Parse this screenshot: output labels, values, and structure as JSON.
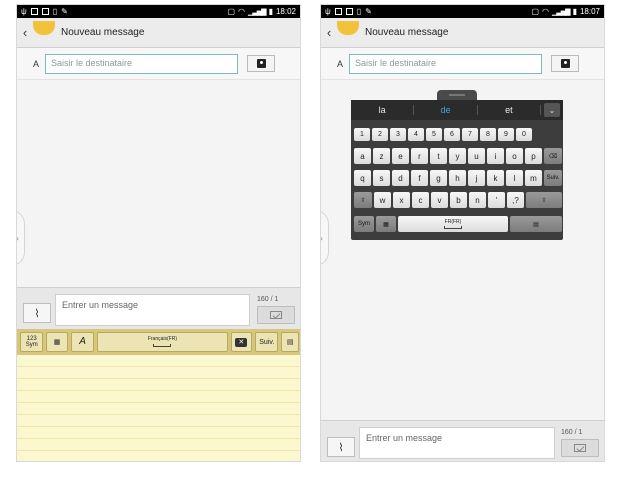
{
  "left": {
    "title": "Nouveau message",
    "recipient_label": "A",
    "recipient_placeholder": "Saisir le destinataire",
    "message_placeholder": "Entrer un message",
    "counter": "160 / 1",
    "status_time": "18:02",
    "toolbar": {
      "sym_label": "123\nSym",
      "space_label": "Français(FR)",
      "next_label": "Suiv."
    }
  },
  "right": {
    "title": "Nouveau message",
    "recipient_label": "A",
    "recipient_placeholder": "Saisir le destinataire",
    "message_placeholder": "Entrer un message",
    "counter": "160 / 1",
    "status_time": "18:07",
    "predictions": [
      "la",
      "de",
      "et"
    ],
    "keyboard": {
      "numbers": [
        "1",
        "2",
        "3",
        "4",
        "5",
        "6",
        "7",
        "8",
        "9",
        "0"
      ],
      "row1": [
        "a",
        "z",
        "e",
        "r",
        "t",
        "y",
        "u",
        "i",
        "o",
        "p"
      ],
      "row2": [
        "q",
        "s",
        "d",
        "f",
        "g",
        "h",
        "j",
        "k",
        "l",
        "m"
      ],
      "row3": [
        "w",
        "x",
        "c",
        "v",
        "b",
        "n",
        "'"
      ],
      "sym_label": "Sym",
      "space_label": "FR(FR)",
      "next_label": "Suiv."
    }
  },
  "colors": {
    "accent": "#3aa7e0",
    "toolbar": "#d6c77a",
    "paper": "#fbf7cf",
    "keyboard_bg": "#3d3d3d"
  }
}
